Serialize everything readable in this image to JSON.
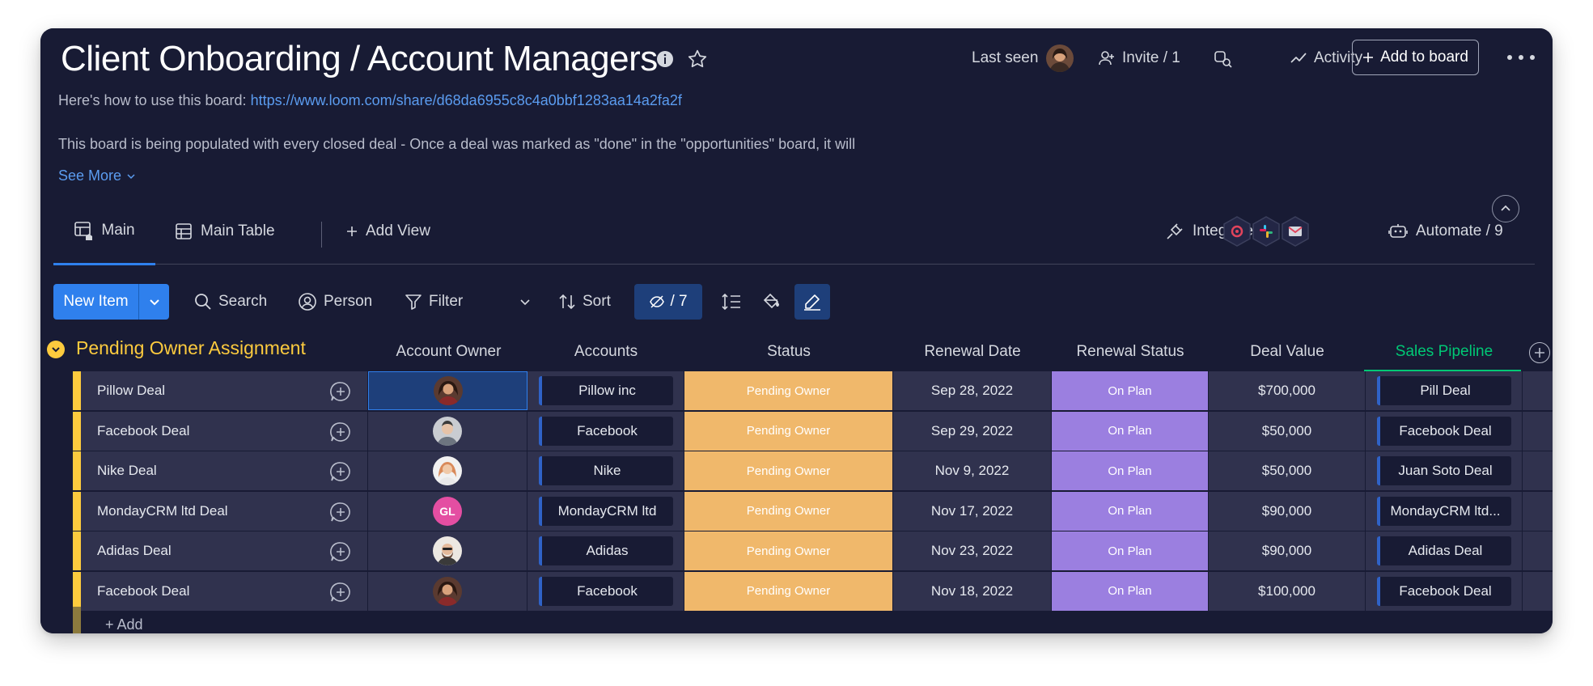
{
  "board": {
    "title": "Client Onboarding / Account Managers",
    "description_prefix": "Here's how to use this board: ",
    "description_link": "https://www.loom.com/share/d68da6955c8c4a0bbf1283aa14a2fa2f",
    "description_text": "This board is being populated with every closed deal - Once a deal was marked as \"done\" in the \"opportunities\" board, it will",
    "see_more": "See More"
  },
  "header": {
    "last_seen": "Last seen",
    "invite": "Invite / 1",
    "activity": "Activity",
    "add_to_board": "Add to board"
  },
  "tabs": {
    "main": "Main",
    "main_table": "Main Table",
    "add_view": "Add View",
    "integrate": "Integrate",
    "automate": "Automate / 9"
  },
  "toolbar": {
    "new_item": "New Item",
    "search": "Search",
    "person": "Person",
    "filter": "Filter",
    "sort": "Sort",
    "hidden": "/ 7"
  },
  "group": {
    "title": "Pending Owner Assignment",
    "add_row": "+ Add"
  },
  "columns": {
    "owner": "Account Owner",
    "accounts": "Accounts",
    "status": "Status",
    "renewal_date": "Renewal Date",
    "renewal_status": "Renewal Status",
    "deal_value": "Deal Value",
    "pipeline": "Sales Pipeline"
  },
  "rows": [
    {
      "name": "Pillow Deal",
      "owner": "photo-1",
      "account": "Pillow inc",
      "status": "Pending Owner",
      "date": "Sep 28, 2022",
      "renewal": "On Plan",
      "value": "$700,000",
      "pipeline": "Pill Deal"
    },
    {
      "name": "Facebook Deal",
      "owner": "photo-2",
      "account": "Facebook",
      "status": "Pending Owner",
      "date": "Sep 29, 2022",
      "renewal": "On Plan",
      "value": "$50,000",
      "pipeline": "Facebook Deal"
    },
    {
      "name": "Nike Deal",
      "owner": "photo-3",
      "account": "Nike",
      "status": "Pending Owner",
      "date": "Nov 9, 2022",
      "renewal": "On Plan",
      "value": "$50,000",
      "pipeline": "Juan Soto Deal"
    },
    {
      "name": "MondayCRM ltd Deal",
      "owner": "GL",
      "account": "MondayCRM ltd",
      "status": "Pending Owner",
      "date": "Nov 17, 2022",
      "renewal": "On Plan",
      "value": "$90,000",
      "pipeline": "MondayCRM ltd..."
    },
    {
      "name": "Adidas Deal",
      "owner": "photo-4",
      "account": "Adidas",
      "status": "Pending Owner",
      "date": "Nov 23, 2022",
      "renewal": "On Plan",
      "value": "$90,000",
      "pipeline": "Adidas Deal"
    },
    {
      "name": "Facebook Deal",
      "owner": "photo-1",
      "account": "Facebook",
      "status": "Pending Owner",
      "date": "Nov 18, 2022",
      "renewal": "On Plan",
      "value": "$100,000",
      "pipeline": "Facebook Deal"
    }
  ],
  "colors": {
    "background": "#181b34",
    "row": "#30324e",
    "accent": "#2f80ed",
    "group": "#fdcb3e",
    "status_pending": "#f0b86b",
    "status_on_plan": "#9b7fe0",
    "pipeline": "#00c875"
  }
}
